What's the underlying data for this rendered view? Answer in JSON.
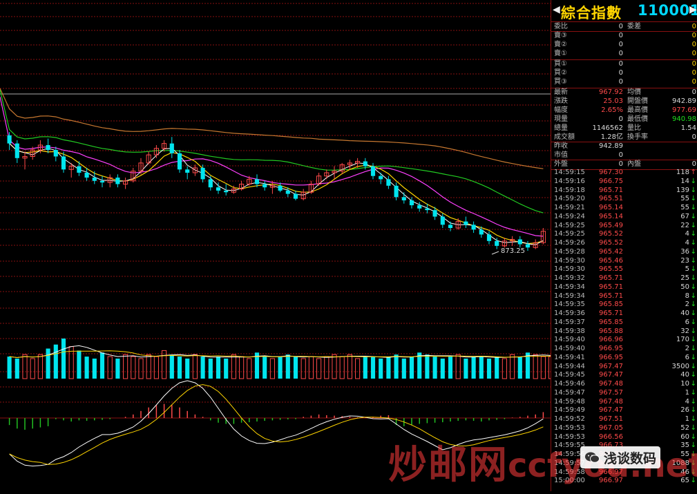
{
  "header": {
    "left_arrow": "◀",
    "right_arrow": "▶",
    "index_name": "綜合指數",
    "index_code": "110001"
  },
  "ratio": {
    "label1": "委比",
    "value1": "0",
    "label2": "委差",
    "value2": "0"
  },
  "sell_orders": [
    {
      "label": "賣③",
      "price": "0",
      "volume": "0"
    },
    {
      "label": "賣②",
      "price": "0",
      "volume": "0"
    },
    {
      "label": "賣①",
      "price": "0",
      "volume": "0"
    }
  ],
  "buy_orders": [
    {
      "label": "買①",
      "price": "0",
      "volume": "0"
    },
    {
      "label": "買②",
      "price": "0",
      "volume": "0"
    },
    {
      "label": "買③",
      "price": "0",
      "volume": "0"
    }
  ],
  "quote": [
    {
      "l1": "最新",
      "v1": "967.92",
      "c1": "red",
      "l2": "均價",
      "v2": "0",
      "c2": "white"
    },
    {
      "l1": "漲跌",
      "v1": "25.03",
      "c1": "red",
      "l2": "開盤價",
      "v2": "942.89",
      "c2": "white"
    },
    {
      "l1": "幅度",
      "v1": "2.65%",
      "c1": "red",
      "l2": "最高價",
      "v2": "977.69",
      "c2": "red"
    },
    {
      "l1": "現量",
      "v1": "0",
      "c1": "white",
      "l2": "最低價",
      "v2": "940.98",
      "c2": "green"
    },
    {
      "l1": "總量",
      "v1": "1146562",
      "c1": "white",
      "l2": "量比",
      "v2": "1.54",
      "c2": "white"
    },
    {
      "l1": "成交額",
      "v1": "1.28亿",
      "c1": "white",
      "l2": "換手率",
      "v2": "0",
      "c2": "white"
    },
    {
      "l1": "昨收",
      "v1": "942.89",
      "c1": "white",
      "l2": "",
      "v2": "",
      "c2": "white"
    },
    {
      "l1": "市值",
      "v1": "0",
      "c1": "white",
      "l2": "",
      "v2": "",
      "c2": "white"
    },
    {
      "l1": "外盤",
      "v1": "0",
      "c1": "white",
      "l2": "內盤",
      "v2": "0",
      "c2": "white"
    }
  ],
  "ticks": [
    {
      "time": "14:59:15",
      "price": "967.30",
      "vol": "118",
      "dir": "up"
    },
    {
      "time": "14:59:16",
      "price": "966.75",
      "vol": "14",
      "dir": "down"
    },
    {
      "time": "14:59:18",
      "price": "965.71",
      "vol": "139",
      "dir": "down"
    },
    {
      "time": "14:59:20",
      "price": "965.51",
      "vol": "55",
      "dir": "down"
    },
    {
      "time": "14:59:21",
      "price": "965.14",
      "vol": "55",
      "dir": "down"
    },
    {
      "time": "14:59:24",
      "price": "965.14",
      "vol": "67",
      "dir": "down"
    },
    {
      "time": "14:59:25",
      "price": "965.49",
      "vol": "22",
      "dir": "down"
    },
    {
      "time": "14:59:25",
      "price": "965.52",
      "vol": "4",
      "dir": "down"
    },
    {
      "time": "14:59:26",
      "price": "965.52",
      "vol": "4",
      "dir": "down"
    },
    {
      "time": "14:59:28",
      "price": "965.42",
      "vol": "36",
      "dir": "down"
    },
    {
      "time": "14:59:30",
      "price": "965.46",
      "vol": "23",
      "dir": "down"
    },
    {
      "time": "14:59:30",
      "price": "965.55",
      "vol": "5",
      "dir": "down"
    },
    {
      "time": "14:59:32",
      "price": "965.71",
      "vol": "25",
      "dir": "down"
    },
    {
      "time": "14:59:34",
      "price": "965.71",
      "vol": "50",
      "dir": "down"
    },
    {
      "time": "14:59:34",
      "price": "965.71",
      "vol": "8",
      "dir": "down"
    },
    {
      "time": "14:59:35",
      "price": "965.85",
      "vol": "2",
      "dir": "down"
    },
    {
      "time": "14:59:36",
      "price": "965.71",
      "vol": "40",
      "dir": "down"
    },
    {
      "time": "14:59:37",
      "price": "965.85",
      "vol": "6",
      "dir": "down"
    },
    {
      "time": "14:59:38",
      "price": "965.88",
      "vol": "32",
      "dir": "down"
    },
    {
      "time": "14:59:40",
      "price": "966.96",
      "vol": "170",
      "dir": "down"
    },
    {
      "time": "14:59:40",
      "price": "966.95",
      "vol": "2",
      "dir": "down"
    },
    {
      "time": "14:59:41",
      "price": "966.95",
      "vol": "6",
      "dir": "down"
    },
    {
      "time": "14:59:44",
      "price": "967.47",
      "vol": "3500",
      "dir": "down"
    },
    {
      "time": "14:59:45",
      "price": "967.47",
      "vol": "40",
      "dir": "down"
    },
    {
      "time": "14:59:46",
      "price": "967.48",
      "vol": "10",
      "dir": "down"
    },
    {
      "time": "14:59:47",
      "price": "967.57",
      "vol": "1",
      "dir": "down"
    },
    {
      "time": "14:59:48",
      "price": "967.48",
      "vol": "4",
      "dir": "down"
    },
    {
      "time": "14:59:49",
      "price": "967.47",
      "vol": "26",
      "dir": "down"
    },
    {
      "time": "14:59:52",
      "price": "967.51",
      "vol": "1",
      "dir": "down"
    },
    {
      "time": "14:59:53",
      "price": "967.05",
      "vol": "52",
      "dir": "down"
    },
    {
      "time": "14:59:53",
      "price": "966.56",
      "vol": "60",
      "dir": "down"
    },
    {
      "time": "14:59:55",
      "price": "966.73",
      "vol": "35",
      "dir": "down"
    },
    {
      "time": "14:59:56",
      "price": "966.77",
      "vol": "55",
      "dir": "down"
    },
    {
      "time": "14:59:57",
      "price": "966.93",
      "vol": "1088",
      "dir": "down"
    },
    {
      "time": "14:59:58",
      "price": "966.97",
      "vol": "46",
      "dir": "down"
    },
    {
      "time": "15:00:00",
      "price": "966.97",
      "vol": "65",
      "dir": "down"
    }
  ],
  "chart": {
    "low_label": "873.25"
  },
  "watermark": {
    "text_main": "炒邮网",
    "text_domain": "ccfyou.net",
    "text_account": "浅谈数码"
  },
  "colors": {
    "up": "#ff4a4a",
    "down": "#00e5ee",
    "grid": "#8a1010",
    "ma5": "#ffffff",
    "ma10": "#ffd500",
    "ma20": "#ff40ff",
    "ma30": "#22cc22",
    "ma60": "#c87830"
  },
  "chart_data": {
    "type": "candlestick",
    "candles": [
      {
        "o": 919,
        "h": 921,
        "l": 910,
        "c": 914
      },
      {
        "o": 914,
        "h": 916,
        "l": 902,
        "c": 905
      },
      {
        "o": 905,
        "h": 909,
        "l": 898,
        "c": 906
      },
      {
        "o": 906,
        "h": 912,
        "l": 904,
        "c": 910
      },
      {
        "o": 910,
        "h": 916,
        "l": 908,
        "c": 913
      },
      {
        "o": 913,
        "h": 917,
        "l": 908,
        "c": 910
      },
      {
        "o": 910,
        "h": 912,
        "l": 903,
        "c": 906
      },
      {
        "o": 906,
        "h": 909,
        "l": 896,
        "c": 898
      },
      {
        "o": 898,
        "h": 902,
        "l": 893,
        "c": 900
      },
      {
        "o": 900,
        "h": 903,
        "l": 894,
        "c": 896
      },
      {
        "o": 896,
        "h": 899,
        "l": 891,
        "c": 893
      },
      {
        "o": 893,
        "h": 897,
        "l": 889,
        "c": 891
      },
      {
        "o": 891,
        "h": 894,
        "l": 887,
        "c": 890
      },
      {
        "o": 890,
        "h": 895,
        "l": 887,
        "c": 893
      },
      {
        "o": 893,
        "h": 895,
        "l": 887,
        "c": 889
      },
      {
        "o": 889,
        "h": 893,
        "l": 886,
        "c": 891
      },
      {
        "o": 891,
        "h": 899,
        "l": 890,
        "c": 897
      },
      {
        "o": 897,
        "h": 905,
        "l": 895,
        "c": 902
      },
      {
        "o": 902,
        "h": 909,
        "l": 901,
        "c": 907
      },
      {
        "o": 907,
        "h": 913,
        "l": 905,
        "c": 911
      },
      {
        "o": 911,
        "h": 916,
        "l": 909,
        "c": 914
      },
      {
        "o": 914,
        "h": 918,
        "l": 905,
        "c": 908
      },
      {
        "o": 908,
        "h": 910,
        "l": 896,
        "c": 898
      },
      {
        "o": 898,
        "h": 900,
        "l": 892,
        "c": 896
      },
      {
        "o": 896,
        "h": 901,
        "l": 894,
        "c": 899
      },
      {
        "o": 899,
        "h": 901,
        "l": 890,
        "c": 892
      },
      {
        "o": 892,
        "h": 894,
        "l": 885,
        "c": 887
      },
      {
        "o": 887,
        "h": 890,
        "l": 883,
        "c": 885
      },
      {
        "o": 885,
        "h": 889,
        "l": 882,
        "c": 884
      },
      {
        "o": 884,
        "h": 888,
        "l": 883,
        "c": 886
      },
      {
        "o": 886,
        "h": 891,
        "l": 885,
        "c": 889
      },
      {
        "o": 889,
        "h": 894,
        "l": 888,
        "c": 892
      },
      {
        "o": 892,
        "h": 895,
        "l": 887,
        "c": 889
      },
      {
        "o": 889,
        "h": 891,
        "l": 885,
        "c": 887
      },
      {
        "o": 887,
        "h": 891,
        "l": 883,
        "c": 888
      },
      {
        "o": 888,
        "h": 890,
        "l": 884,
        "c": 885
      },
      {
        "o": 885,
        "h": 887,
        "l": 881,
        "c": 883
      },
      {
        "o": 883,
        "h": 885,
        "l": 879,
        "c": 880
      },
      {
        "o": 880,
        "h": 886,
        "l": 879,
        "c": 884
      },
      {
        "o": 884,
        "h": 891,
        "l": 883,
        "c": 889
      },
      {
        "o": 889,
        "h": 896,
        "l": 888,
        "c": 894
      },
      {
        "o": 894,
        "h": 898,
        "l": 892,
        "c": 896
      },
      {
        "o": 896,
        "h": 900,
        "l": 892,
        "c": 897
      },
      {
        "o": 897,
        "h": 902,
        "l": 895,
        "c": 901
      },
      {
        "o": 901,
        "h": 904,
        "l": 898,
        "c": 902
      },
      {
        "o": 902,
        "h": 905,
        "l": 899,
        "c": 903
      },
      {
        "o": 903,
        "h": 905,
        "l": 898,
        "c": 900
      },
      {
        "o": 900,
        "h": 902,
        "l": 892,
        "c": 894
      },
      {
        "o": 894,
        "h": 896,
        "l": 889,
        "c": 892
      },
      {
        "o": 892,
        "h": 894,
        "l": 886,
        "c": 888
      },
      {
        "o": 888,
        "h": 890,
        "l": 879,
        "c": 881
      },
      {
        "o": 881,
        "h": 884,
        "l": 877,
        "c": 879
      },
      {
        "o": 879,
        "h": 881,
        "l": 874,
        "c": 876
      },
      {
        "o": 876,
        "h": 878,
        "l": 872,
        "c": 874
      },
      {
        "o": 874,
        "h": 877,
        "l": 871,
        "c": 873
      },
      {
        "o": 873,
        "h": 875,
        "l": 867,
        "c": 869
      },
      {
        "o": 869,
        "h": 871,
        "l": 862,
        "c": 864
      },
      {
        "o": 864,
        "h": 866,
        "l": 860,
        "c": 862
      },
      {
        "o": 862,
        "h": 868,
        "l": 861,
        "c": 866
      },
      {
        "o": 866,
        "h": 869,
        "l": 862,
        "c": 864
      },
      {
        "o": 864,
        "h": 866,
        "l": 859,
        "c": 861
      },
      {
        "o": 861,
        "h": 863,
        "l": 856,
        "c": 858
      },
      {
        "o": 858,
        "h": 860,
        "l": 852,
        "c": 854
      },
      {
        "o": 854,
        "h": 856,
        "l": 849,
        "c": 851
      },
      {
        "o": 851,
        "h": 856,
        "l": 850,
        "c": 854
      },
      {
        "o": 854,
        "h": 857,
        "l": 851,
        "c": 855
      },
      {
        "o": 855,
        "h": 857,
        "l": 850,
        "c": 852
      },
      {
        "o": 852,
        "h": 854,
        "l": 848,
        "c": 850
      },
      {
        "o": 850,
        "h": 855,
        "l": 849,
        "c": 853
      },
      {
        "o": 853,
        "h": 862,
        "l": 852,
        "c": 860
      }
    ],
    "volume_ratio": [
      0.55,
      0.5,
      0.6,
      0.5,
      0.6,
      0.75,
      0.85,
      1.0,
      0.8,
      0.7,
      0.55,
      0.5,
      0.65,
      0.55,
      0.5,
      0.6,
      0.55,
      0.5,
      0.6,
      0.55,
      0.7,
      0.6,
      0.55,
      0.5,
      0.6,
      0.55,
      0.5,
      0.55,
      0.5,
      0.6,
      0.55,
      0.5,
      0.65,
      0.55,
      0.5,
      0.55,
      0.6,
      0.55,
      0.5,
      0.55,
      0.5,
      0.55,
      0.6,
      0.55,
      0.6,
      0.5,
      0.55,
      0.55,
      0.5,
      0.55,
      0.6,
      0.5,
      0.55,
      0.65,
      0.6,
      0.55,
      0.5,
      0.55,
      0.6,
      0.5,
      0.55,
      0.55,
      0.5,
      0.55,
      0.5,
      0.6,
      0.55,
      0.65,
      0.6,
      0.55,
      0.55
    ],
    "macd": [
      -0.3,
      -0.45,
      -0.5,
      -0.45,
      -0.4,
      -0.35,
      -0.05,
      -0.1,
      -0.15,
      -0.1,
      -0.12,
      -0.1,
      -0.08,
      -0.05,
      0.0,
      0.05,
      0.15,
      0.3,
      0.45,
      0.55,
      0.6,
      0.55,
      0.45,
      0.3,
      0.15,
      0.05,
      -0.1,
      -0.2,
      -0.25,
      -0.25,
      -0.2,
      -0.18,
      -0.15,
      -0.12,
      -0.1,
      -0.08,
      -0.06,
      -0.05,
      0.05,
      0.1,
      0.15,
      0.12,
      0.1,
      0.08,
      0.05,
      0.03,
      0.02,
      0.05,
      0.1,
      0.12,
      -0.3,
      -0.35,
      -0.3,
      -0.25,
      -0.22,
      -0.2,
      -0.18,
      -0.15,
      -0.12,
      -0.1,
      -0.12,
      -0.15,
      -0.1,
      -0.08,
      -0.05,
      0.02,
      0.05,
      0.1,
      0.15,
      0.25
    ]
  }
}
